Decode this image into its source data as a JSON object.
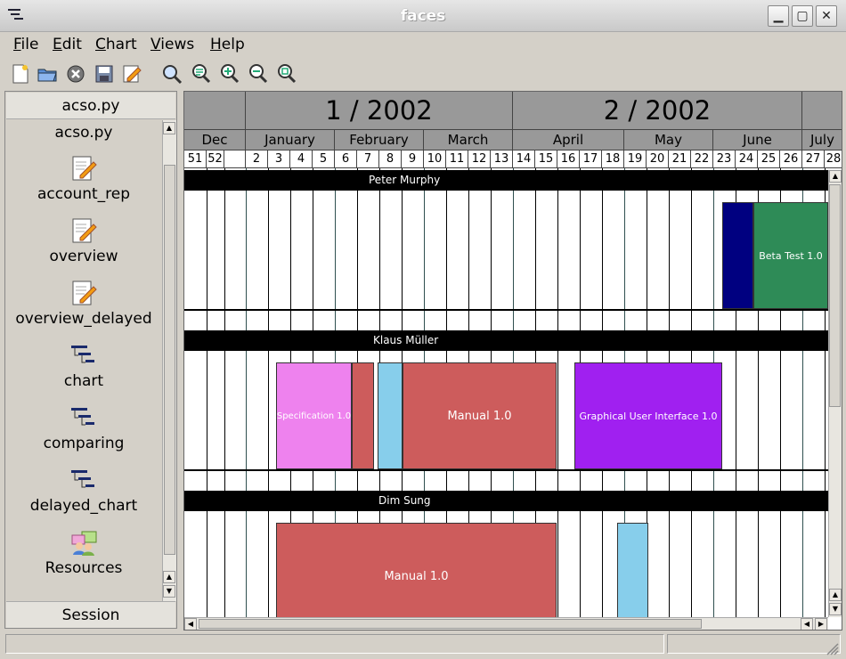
{
  "window": {
    "title": "faces"
  },
  "menu": {
    "file": "File",
    "edit": "Edit",
    "chart": "Chart",
    "views": "Views",
    "help": "Help"
  },
  "toolbar": {
    "icons": [
      "new-file-icon",
      "open-folder-icon",
      "close-icon",
      "save-icon",
      "edit-icon",
      "zoom-icon",
      "zoom-fit-icon",
      "zoom-in-icon",
      "zoom-out-icon",
      "zoom-reset-icon"
    ]
  },
  "sidebar": {
    "header": "acso.py",
    "title": "acso.py",
    "items": [
      {
        "label": "account_rep",
        "icon": "edit-document-icon"
      },
      {
        "label": "overview",
        "icon": "edit-document-icon"
      },
      {
        "label": "overview_delayed",
        "icon": "edit-document-icon"
      },
      {
        "label": "chart",
        "icon": "gantt-chart-icon"
      },
      {
        "label": "comparing",
        "icon": "gantt-chart-icon"
      },
      {
        "label": "delayed_chart",
        "icon": "gantt-chart-icon"
      },
      {
        "label": "Resources",
        "icon": "resources-icon"
      }
    ],
    "footer": "Session"
  },
  "chart": {
    "quarters": [
      "1 / 2002",
      "2 / 2002"
    ],
    "months": [
      "Dec",
      "January",
      "February",
      "March",
      "April",
      "May",
      "June",
      "July"
    ],
    "weeks": [
      "51",
      "52",
      "",
      "2",
      "3",
      "4",
      "5",
      "6",
      "7",
      "8",
      "9",
      "10",
      "11",
      "12",
      "13",
      "14",
      "15",
      "16",
      "17",
      "18",
      "19",
      "20",
      "21",
      "22",
      "23",
      "24",
      "25",
      "26",
      "27",
      "28"
    ],
    "resources": [
      {
        "name": "Peter Murphy",
        "tasks": [
          {
            "label": "",
            "color": "#000080"
          },
          {
            "label": "Beta Test 1.0",
            "color": "#2e8b57"
          }
        ]
      },
      {
        "name": "Klaus Müller",
        "tasks": [
          {
            "label": "Specification 1.0",
            "color": "#ee82ee"
          },
          {
            "label": "",
            "color": "#cd5c5c"
          },
          {
            "label": "",
            "color": "#87ceeb"
          },
          {
            "label": "Manual 1.0",
            "color": "#cd5c5c"
          },
          {
            "label": "Graphical User Interface 1.0",
            "color": "#a020f0"
          }
        ]
      },
      {
        "name": "Dim Sung",
        "tasks": [
          {
            "label": "Manual 1.0",
            "color": "#cd5c5c"
          },
          {
            "label": "",
            "color": "#87ceeb"
          }
        ]
      }
    ]
  }
}
